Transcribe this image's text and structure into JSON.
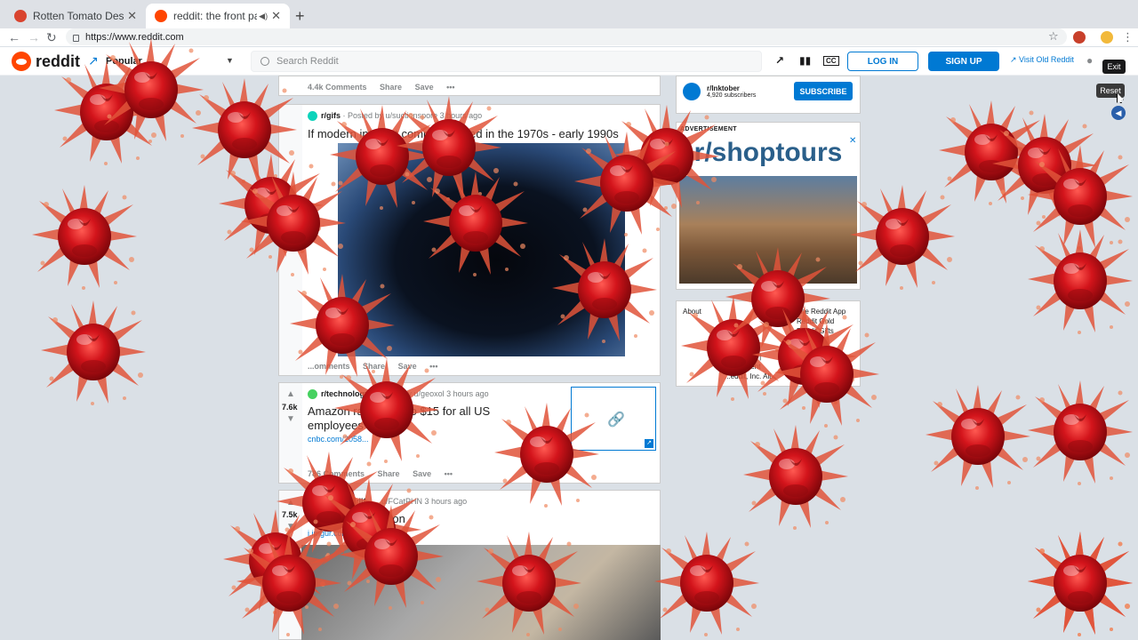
{
  "browser": {
    "tabs": [
      {
        "title": "Rotten Tomato Destroyer - Chr",
        "active": false
      },
      {
        "title": "reddit: the front page of the",
        "active": true
      }
    ],
    "url": "https://www.reddit.com"
  },
  "header": {
    "logo_text": "reddit",
    "feed_label": "Popular",
    "search_placeholder": "Search Reddit",
    "login": "LOG IN",
    "signup": "SIGN UP",
    "old_reddit": "Visit Old Reddit"
  },
  "posts": [
    {
      "actions": {
        "comments": "4.4k Comments",
        "share": "Share",
        "save": "Save"
      }
    },
    {
      "subreddit": "r/gifs",
      "posted_by": "· Posted by u/suctionspore 3 hours ago",
      "title": "If modern internet compa...existed in the 1970s - early 1990s",
      "actions": {
        "comments": "...omments",
        "share": "Share",
        "save": "Save"
      }
    },
    {
      "subreddit": "r/technology",
      "posted_by": "· Posted by u/geoxol 3 hours ago",
      "votes": "7.6k",
      "title_line1": "Amazon ra... wage to $15 for all US",
      "title_line2": "employees",
      "link": "cnbc.com/2058...",
      "actions": {
        "comments": "786 Comments",
        "share": "Share",
        "save": "Save"
      }
    },
    {
      "subreddit": "r/thisismylif...",
      "posted_by": "...u/FCatPHN 3 hours ago",
      "votes": "7.5k",
      "title": "Otter accep... ation",
      "link": "i.imgur.com/..."
    }
  ],
  "sidebar": {
    "community": {
      "name": "r/Inktober",
      "subscribers": "4,920 subscribers",
      "button": "SUBSCRIBE"
    },
    "ad": {
      "label": "ADVERTISEMENT",
      "title": "r/shoptours"
    },
    "footer": {
      "about": "About",
      "help": "He...",
      "app": "The Reddit App",
      "gold": "Reddit Gold",
      "gifts": "Reddit Gifts",
      "policy": "...nt Policy |",
      "agreement": "...greement",
      "copyright": "...eddit, Inc. All..."
    }
  },
  "extension": {
    "exit": "Exit",
    "reset": "Reset"
  },
  "colors": {
    "reddit_orange": "#ff4500",
    "reddit_blue": "#0079d3",
    "tomato_red": "#c8141e"
  }
}
